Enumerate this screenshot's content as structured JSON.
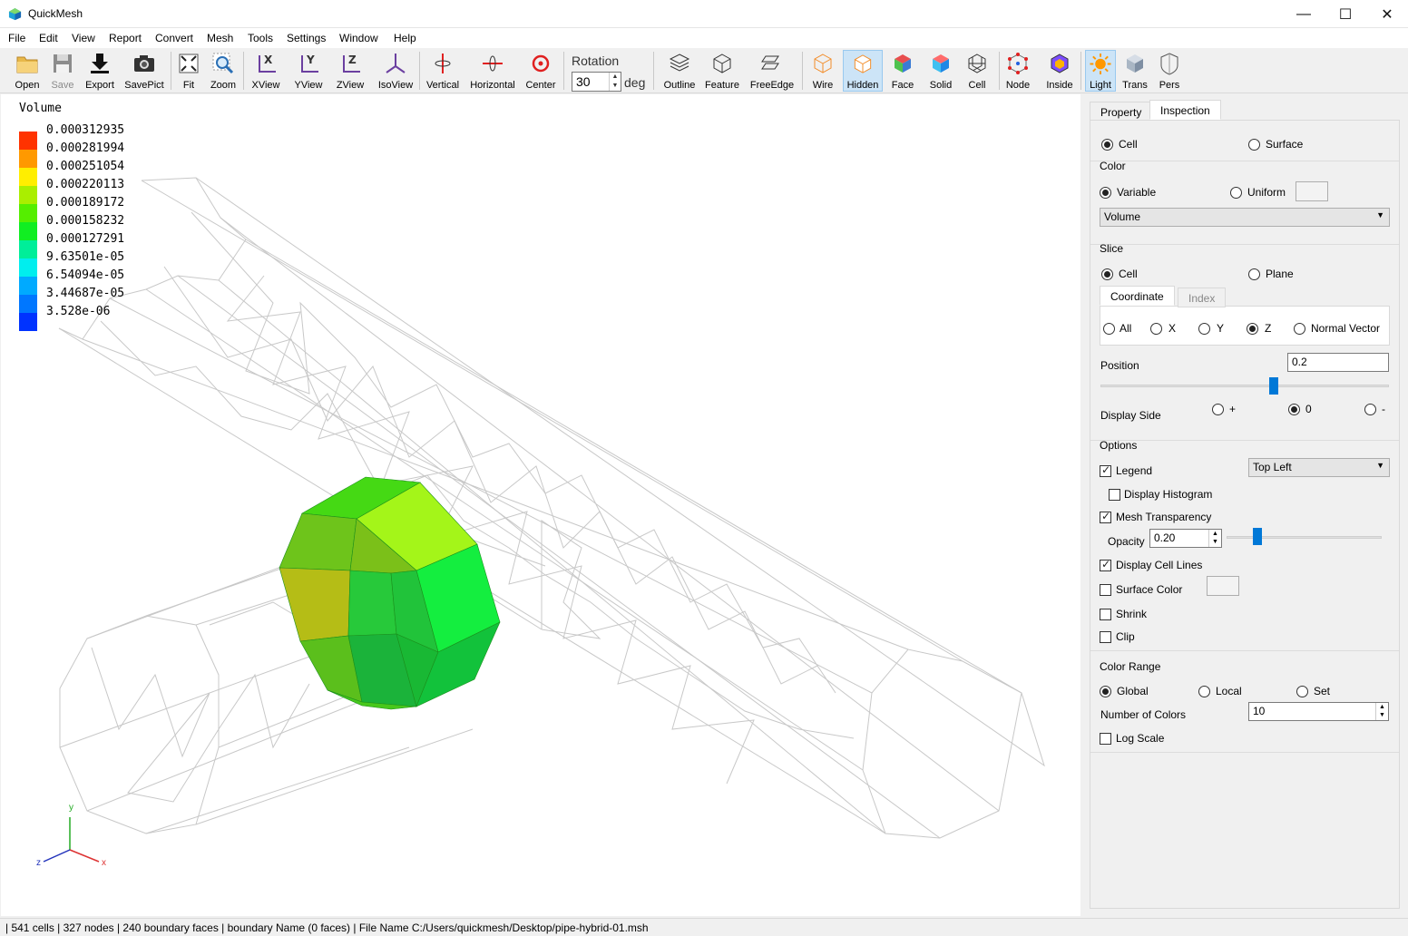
{
  "window": {
    "title": "QuickMesh",
    "minimize": "—",
    "maximize": "☐",
    "close": "✕"
  },
  "menu": [
    "File",
    "Edit",
    "View",
    "Report",
    "Convert",
    "Mesh",
    "Tools",
    "Settings",
    "Window",
    "Help"
  ],
  "toolbar": {
    "buttons": [
      {
        "label": "Open",
        "icon": "folder-icon"
      },
      {
        "label": "Save",
        "icon": "floppy-icon"
      },
      {
        "label": "Export",
        "icon": "download-icon"
      },
      {
        "label": "SavePict",
        "icon": "camera-icon"
      },
      {
        "label": "Fit",
        "icon": "fit-icon"
      },
      {
        "label": "Zoom",
        "icon": "zoom-icon"
      },
      {
        "label": "XView",
        "icon": "xview-icon"
      },
      {
        "label": "YView",
        "icon": "yview-icon"
      },
      {
        "label": "ZView",
        "icon": "zview-icon"
      },
      {
        "label": "IsoView",
        "icon": "isoview-icon"
      },
      {
        "label": "Vertical",
        "icon": "vertical-rotate-icon"
      },
      {
        "label": "Horizontal",
        "icon": "horizontal-rotate-icon"
      },
      {
        "label": "Center",
        "icon": "center-icon"
      },
      {
        "label": "Outline",
        "icon": "outline-icon"
      },
      {
        "label": "Feature",
        "icon": "feature-icon"
      },
      {
        "label": "FreeEdge",
        "icon": "free-edge-icon"
      },
      {
        "label": "Wire",
        "icon": "wire-icon"
      },
      {
        "label": "Hidden",
        "icon": "hidden-icon"
      },
      {
        "label": "Face",
        "icon": "face-icon"
      },
      {
        "label": "Solid",
        "icon": "solid-icon"
      },
      {
        "label": "Cell",
        "icon": "cell-icon"
      },
      {
        "label": "Node",
        "icon": "node-icon"
      },
      {
        "label": "Inside",
        "icon": "inside-icon"
      },
      {
        "label": "Light",
        "icon": "light-icon"
      },
      {
        "label": "Trans",
        "icon": "transparent-icon"
      },
      {
        "label": "Pers",
        "icon": "perspective-icon"
      }
    ],
    "rotation_label": "Rotation",
    "rotation_value": "30",
    "rotation_unit": "deg"
  },
  "legend": {
    "title": "Volume",
    "entries": [
      {
        "value": "0.000312935",
        "color": "#ff3300"
      },
      {
        "value": "0.000281994",
        "color": "#ff9900"
      },
      {
        "value": "0.000251054",
        "color": "#ffee00"
      },
      {
        "value": "0.000220113",
        "color": "#aaee00"
      },
      {
        "value": "0.000189172",
        "color": "#55ee00"
      },
      {
        "value": "0.000158232",
        "color": "#11ee22"
      },
      {
        "value": "0.000127291",
        "color": "#00ee99"
      },
      {
        "value": "9.63501e-05",
        "color": "#00eeee"
      },
      {
        "value": "6.54094e-05",
        "color": "#00aaff"
      },
      {
        "value": "3.44687e-05",
        "color": "#0077ff"
      },
      {
        "value": "3.528e-06",
        "color": "#0033ff"
      }
    ]
  },
  "axes": {
    "x": "x",
    "y": "y",
    "z": "z"
  },
  "panel": {
    "tabs": [
      "Property",
      "Inspection"
    ],
    "mode": {
      "cell": "Cell",
      "surface": "Surface"
    },
    "color": {
      "heading": "Color",
      "variable": "Variable",
      "uniform": "Uniform",
      "selected": "Volume"
    },
    "slice": {
      "heading": "Slice",
      "cell": "Cell",
      "plane": "Plane",
      "subtabs": [
        "Coordinate",
        "Index"
      ],
      "coords": [
        "All",
        "X",
        "Y",
        "Z",
        "Normal Vector"
      ],
      "position_label": "Position",
      "position_value": "0.2",
      "position_fraction": 0.6,
      "display_side_label": "Display Side",
      "sides": [
        "+",
        "0",
        "-"
      ]
    },
    "options": {
      "heading": "Options",
      "legend": "Legend",
      "legend_position": "Top Left",
      "display_histogram": "Display Histogram",
      "mesh_transparency": "Mesh Transparency",
      "opacity_label": "Opacity",
      "opacity_value": "0.20",
      "opacity_fraction": 0.2,
      "display_cell_lines": "Display Cell Lines",
      "surface_color": "Surface Color",
      "shrink": "Shrink",
      "clip": "Clip"
    },
    "color_range": {
      "heading": "Color Range",
      "global": "Global",
      "local": "Local",
      "set": "Set",
      "num_colors_label": "Number of Colors",
      "num_colors_value": "10",
      "log_scale": "Log Scale"
    }
  },
  "status": "| 541 cells | 327 nodes | 240 boundary faces |  boundary Name  (0 faces) | File Name C:/Users/quickmesh/Desktop/pipe-hybrid-01.msh"
}
